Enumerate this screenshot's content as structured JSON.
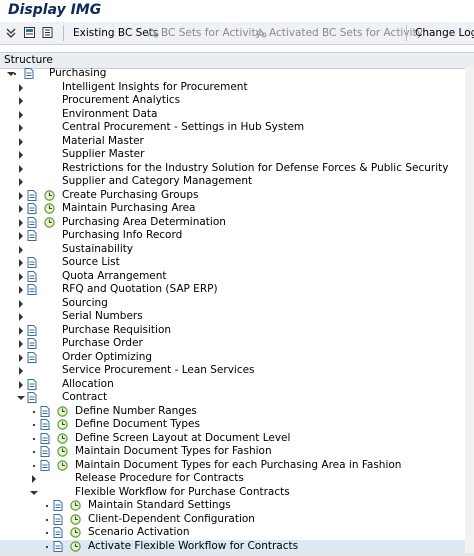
{
  "title": "Display IMG",
  "toolbar": {
    "existing_bc_sets": "Existing BC Sets",
    "bc_sets_for_activity": "BC Sets for Activity",
    "activated_bc_sets": "Activated BC Sets for Activity",
    "change_log": "Change Log"
  },
  "structure_header": "Structure",
  "tree": {
    "root": "Purchasing",
    "items": [
      {
        "label": "Intelligent Insights for Procurement",
        "level": 1,
        "icons": "none",
        "expanded": false,
        "selected": false
      },
      {
        "label": "Procurement Analytics",
        "level": 1,
        "icons": "none",
        "expanded": false,
        "selected": false
      },
      {
        "label": "Environment Data",
        "level": 1,
        "icons": "none",
        "expanded": false,
        "selected": false
      },
      {
        "label": "Central Procurement - Settings in Hub System",
        "level": 1,
        "icons": "none",
        "expanded": false,
        "selected": false
      },
      {
        "label": "Material Master",
        "level": 1,
        "icons": "none",
        "expanded": false,
        "selected": false
      },
      {
        "label": "Supplier Master",
        "level": 1,
        "icons": "none",
        "expanded": false,
        "selected": false
      },
      {
        "label": "Restrictions for the Industry Solution for Defense Forces & Public Security",
        "level": 1,
        "icons": "none",
        "expanded": false,
        "selected": false
      },
      {
        "label": "Supplier and Category Management",
        "level": 1,
        "icons": "none",
        "expanded": false,
        "selected": false
      },
      {
        "label": "Create Purchasing Groups",
        "level": 1,
        "icons": "doc-clock",
        "expanded": false,
        "selected": false
      },
      {
        "label": "Maintain Purchasing Area",
        "level": 1,
        "icons": "doc-clock",
        "expanded": false,
        "selected": false
      },
      {
        "label": "Purchasing Area Determination",
        "level": 1,
        "icons": "doc-clock",
        "expanded": false,
        "selected": false
      },
      {
        "label": "Purchasing Info Record",
        "level": 1,
        "icons": "doc",
        "expanded": false,
        "selected": false
      },
      {
        "label": "Sustainability",
        "level": 1,
        "icons": "none",
        "expanded": false,
        "selected": false
      },
      {
        "label": "Source List",
        "level": 1,
        "icons": "doc",
        "expanded": false,
        "selected": false
      },
      {
        "label": "Quota Arrangement",
        "level": 1,
        "icons": "doc",
        "expanded": false,
        "selected": false
      },
      {
        "label": "RFQ and Quotation (SAP ERP)",
        "level": 1,
        "icons": "doc",
        "expanded": false,
        "selected": false
      },
      {
        "label": "Sourcing",
        "level": 1,
        "icons": "none",
        "expanded": false,
        "selected": false
      },
      {
        "label": "Serial Numbers",
        "level": 1,
        "icons": "none",
        "expanded": false,
        "selected": false
      },
      {
        "label": "Purchase Requisition",
        "level": 1,
        "icons": "doc",
        "expanded": false,
        "selected": false
      },
      {
        "label": "Purchase Order",
        "level": 1,
        "icons": "doc",
        "expanded": false,
        "selected": false
      },
      {
        "label": "Order Optimizing",
        "level": 1,
        "icons": "doc",
        "expanded": false,
        "selected": false
      },
      {
        "label": "Service Procurement - Lean Services",
        "level": 1,
        "icons": "none",
        "expanded": false,
        "selected": false
      },
      {
        "label": "Allocation",
        "level": 1,
        "icons": "doc",
        "expanded": false,
        "selected": false
      },
      {
        "label": "Contract",
        "level": 1,
        "icons": "doc",
        "expanded": true,
        "selected": false
      },
      {
        "label": "Define Number Ranges",
        "level": 2,
        "icons": "doc-clock",
        "expanded": false,
        "selected": false
      },
      {
        "label": "Define Document Types",
        "level": 2,
        "icons": "doc-clock",
        "expanded": false,
        "selected": false
      },
      {
        "label": "Define Screen Layout at Document Level",
        "level": 2,
        "icons": "doc-clock",
        "expanded": false,
        "selected": false
      },
      {
        "label": "Maintain Document Types for Fashion",
        "level": 2,
        "icons": "doc-clock",
        "expanded": false,
        "selected": false
      },
      {
        "label": "Maintain Document Types for each Purchasing Area in Fashion",
        "level": 2,
        "icons": "doc-clock",
        "expanded": false,
        "selected": false
      },
      {
        "label": "Release Procedure for Contracts",
        "level": 2,
        "icons": "none",
        "expanded": false,
        "selected": false
      },
      {
        "label": "Flexible Workflow for Purchase Contracts",
        "level": 2,
        "icons": "none",
        "expanded": true,
        "selected": false
      },
      {
        "label": "Maintain Standard Settings",
        "level": 3,
        "icons": "doc-clock",
        "expanded": false,
        "selected": false
      },
      {
        "label": "Client-Dependent Configuration",
        "level": 3,
        "icons": "doc-clock",
        "expanded": false,
        "selected": false
      },
      {
        "label": "Scenario Activation",
        "level": 3,
        "icons": "doc-clock",
        "expanded": false,
        "selected": false
      },
      {
        "label": "Activate Flexible Workflow for Contracts",
        "level": 3,
        "icons": "doc-clock",
        "expanded": false,
        "selected": true
      }
    ]
  },
  "colors": {
    "toolbar_bg": "#eef2f6",
    "selected_row": "#dde8f3",
    "clock_green": "#5a9a2a",
    "doc_blue": "#3a6ea5"
  }
}
